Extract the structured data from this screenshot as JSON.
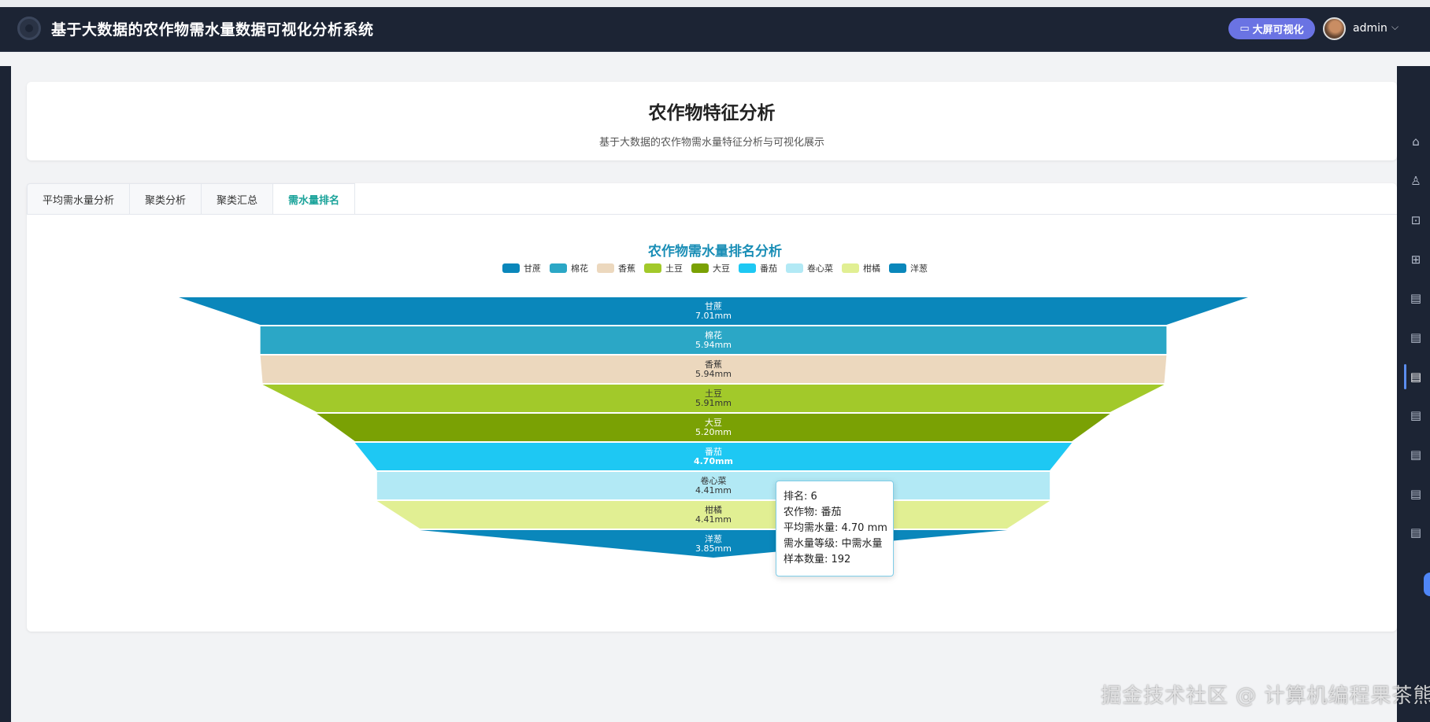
{
  "header": {
    "app_title": "基于大数据的农作物需水量数据可视化分析系统",
    "bigscreen_button": "大屏可视化",
    "username": "admin"
  },
  "page": {
    "title": "农作物特征分析",
    "subtitle": "基于大数据的农作物需水量特征分析与可视化展示"
  },
  "tabs": [
    {
      "label": "平均需水量分析",
      "active": false
    },
    {
      "label": "聚类分析",
      "active": false
    },
    {
      "label": "聚类汇总",
      "active": false
    },
    {
      "label": "需水量排名",
      "active": true
    }
  ],
  "right_rail_icons": [
    "home-icon",
    "user-icon",
    "lock-icon",
    "presentation-icon",
    "document-icon",
    "document-icon",
    "document-icon",
    "document-icon",
    "document-icon",
    "document-icon",
    "document-icon"
  ],
  "chart_data": {
    "type": "funnel",
    "title": "农作物需水量排名分析",
    "unit": "mm",
    "categories": [
      "甘蔗",
      "棉花",
      "香蕉",
      "土豆",
      "大豆",
      "番茄",
      "卷心菜",
      "柑橘",
      "洋葱"
    ],
    "values": [
      7.01,
      5.94,
      5.94,
      5.91,
      5.2,
      4.7,
      4.41,
      4.41,
      3.85
    ],
    "value_labels": [
      "7.01mm",
      "5.94mm",
      "5.94mm",
      "5.91mm",
      "5.20mm",
      "4.70mm",
      "4.41mm",
      "4.41mm",
      "3.85mm"
    ],
    "colors": [
      "#0a87bb",
      "#2ba7c6",
      "#ecd8be",
      "#a2c92a",
      "#7aa104",
      "#1ec8f3",
      "#b2e9f5",
      "#e1ef93",
      "#0a87bb"
    ],
    "legend_position": "top-center",
    "highlighted": "番茄"
  },
  "tooltip": {
    "lines": [
      "排名: 6",
      "农作物: 番茄",
      "平均需水量: 4.70 mm",
      "需水量等级: 中需水量",
      "样本数量: 192"
    ]
  },
  "watermark": "掘金技术社区 @ 计算机编程果茶熊"
}
